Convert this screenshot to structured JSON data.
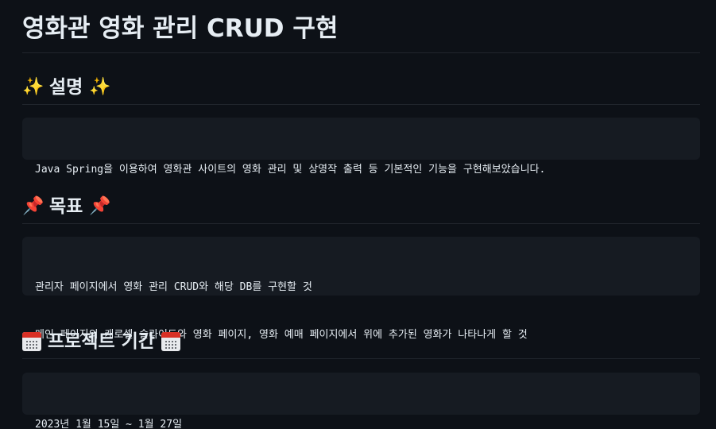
{
  "title": "영화관 영화 관리 CRUD 구현",
  "sections": [
    {
      "heading": "설명",
      "icon": "sparkles-icon",
      "lines": [
        "Java Spring을 이용하여 영화관 사이트의 영화 관리 및 상영작 출력 등 기본적인 기능을 구현해보았습니다."
      ]
    },
    {
      "heading": "목표",
      "icon": "pushpin-icon",
      "lines": [
        "관리자 페이지에서 영화 관리 CRUD와 해당 DB를 구현할 것",
        "메인 페이지의 캐로셀 슬라이드와 영화 페이지, 영화 예매 페이지에서 위에 추가된 영화가 나타나게 할 것"
      ]
    },
    {
      "heading": "프로젝트 기간",
      "icon": "calendar-icon",
      "lines": [
        "2023년 1월 15일 ~ 1월 27일"
      ]
    }
  ],
  "colors": {
    "background": "#0d1117",
    "code_background": "#161b22",
    "text": "#e6edf3",
    "divider": "#21262d"
  }
}
